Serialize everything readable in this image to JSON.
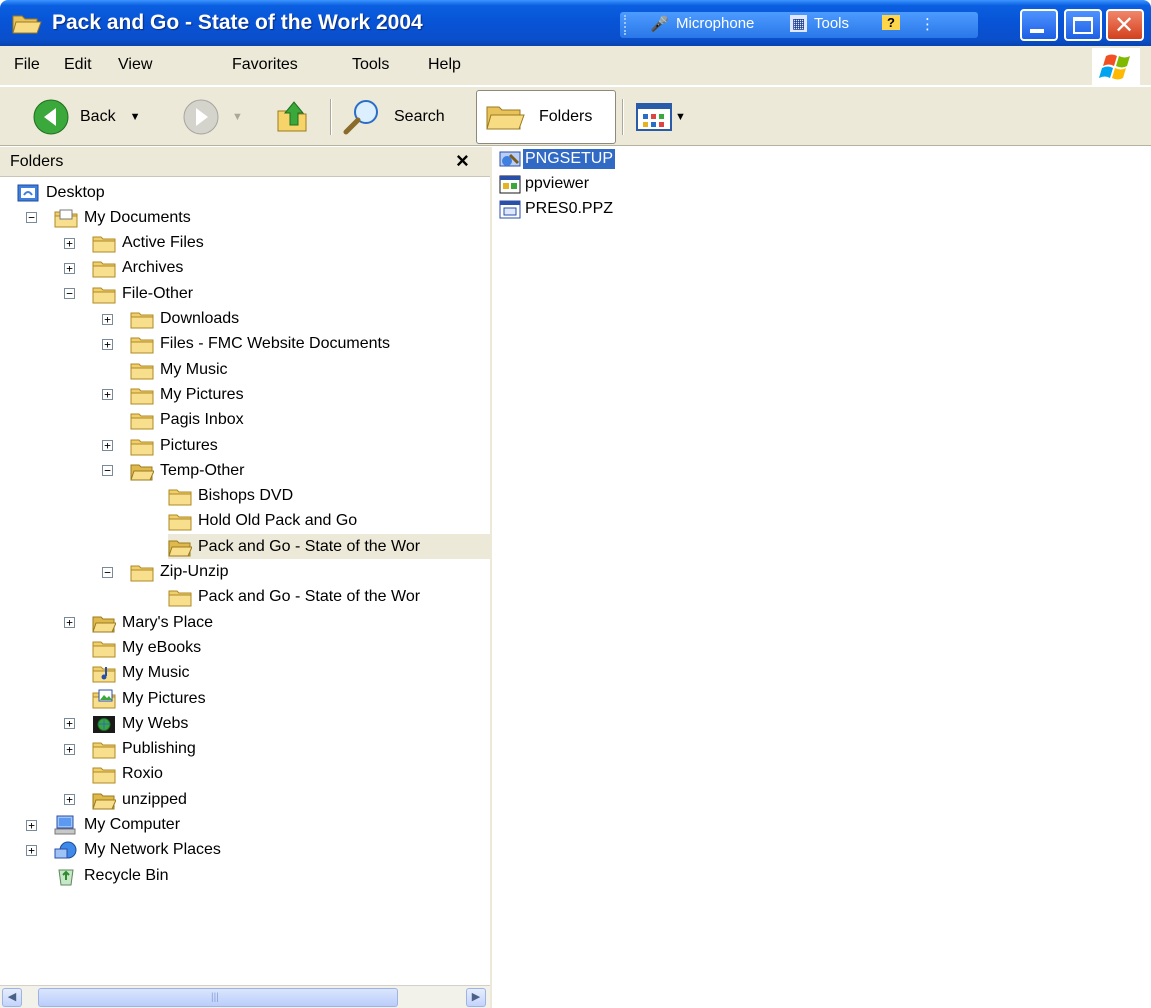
{
  "window": {
    "title": "Pack and Go - State of the Work 2004",
    "language_bar": {
      "microphone": "Microphone",
      "tools": "Tools"
    }
  },
  "menu": [
    "File",
    "Edit",
    "View",
    "Favorites",
    "Tools",
    "Help"
  ],
  "toolbar": {
    "back": "Back",
    "search": "Search",
    "folders": "Folders"
  },
  "folder_pane": {
    "title": "Folders",
    "tree": [
      {
        "label": "Desktop",
        "depth": 0,
        "expander": "",
        "icon": "desktop-icon"
      },
      {
        "label": "My Documents",
        "depth": 1,
        "expander": "−",
        "icon": "my-documents-icon"
      },
      {
        "label": "Active Files",
        "depth": 2,
        "expander": "+",
        "icon": "folder-icon"
      },
      {
        "label": "Archives",
        "depth": 2,
        "expander": "+",
        "icon": "folder-icon"
      },
      {
        "label": "File-Other",
        "depth": 2,
        "expander": "−",
        "icon": "folder-icon"
      },
      {
        "label": "Downloads",
        "depth": 3,
        "expander": "+",
        "icon": "folder-icon"
      },
      {
        "label": "Files - FMC Website Documents",
        "depth": 3,
        "expander": "+",
        "icon": "folder-icon"
      },
      {
        "label": "My Music",
        "depth": 3,
        "expander": "",
        "icon": "folder-icon"
      },
      {
        "label": "My Pictures",
        "depth": 3,
        "expander": "+",
        "icon": "folder-icon"
      },
      {
        "label": "Pagis Inbox",
        "depth": 3,
        "expander": "",
        "icon": "folder-icon"
      },
      {
        "label": "Pictures",
        "depth": 3,
        "expander": "+",
        "icon": "folder-icon"
      },
      {
        "label": "Temp-Other",
        "depth": 3,
        "expander": "−",
        "icon": "open-folder-icon"
      },
      {
        "label": "Bishops DVD",
        "depth": 4,
        "expander": "",
        "icon": "folder-icon"
      },
      {
        "label": "Hold Old Pack and Go",
        "depth": 4,
        "expander": "",
        "icon": "folder-icon"
      },
      {
        "label": "Pack and Go - State of the Wor",
        "depth": 4,
        "expander": "",
        "icon": "open-folder-icon",
        "selected": true
      },
      {
        "label": "Zip-Unzip",
        "depth": 3,
        "expander": "−",
        "icon": "folder-icon"
      },
      {
        "label": "Pack and Go - State of the Wor",
        "depth": 4,
        "expander": "",
        "icon": "folder-icon"
      },
      {
        "label": "Mary's Place",
        "depth": 2,
        "expander": "+",
        "icon": "open-folder-icon"
      },
      {
        "label": "My eBooks",
        "depth": 2,
        "expander": "",
        "icon": "folder-icon"
      },
      {
        "label": "My Music",
        "depth": 2,
        "expander": "",
        "icon": "music-folder-icon"
      },
      {
        "label": "My Pictures",
        "depth": 2,
        "expander": "",
        "icon": "pictures-folder-icon"
      },
      {
        "label": "My Webs",
        "depth": 2,
        "expander": "+",
        "icon": "webs-folder-icon"
      },
      {
        "label": "Publishing",
        "depth": 2,
        "expander": "+",
        "icon": "folder-icon"
      },
      {
        "label": "Roxio",
        "depth": 2,
        "expander": "",
        "icon": "folder-icon"
      },
      {
        "label": "unzipped",
        "depth": 2,
        "expander": "+",
        "icon": "open-folder-icon"
      },
      {
        "label": "My Computer",
        "depth": 1,
        "expander": "+",
        "icon": "my-computer-icon"
      },
      {
        "label": "My Network Places",
        "depth": 1,
        "expander": "+",
        "icon": "network-places-icon"
      },
      {
        "label": "Recycle Bin",
        "depth": 1,
        "expander": "",
        "icon": "recycle-bin-icon"
      }
    ]
  },
  "files": [
    {
      "name": "PNGSETUP",
      "icon": "setup-program-icon",
      "selected": true
    },
    {
      "name": "ppviewer",
      "icon": "application-icon",
      "selected": false
    },
    {
      "name": "PRES0.PPZ",
      "icon": "ppz-file-icon",
      "selected": false
    }
  ],
  "colors": {
    "titlebar": "#0853d6",
    "selection": "#316ac5",
    "chrome": "#ece9d8"
  }
}
